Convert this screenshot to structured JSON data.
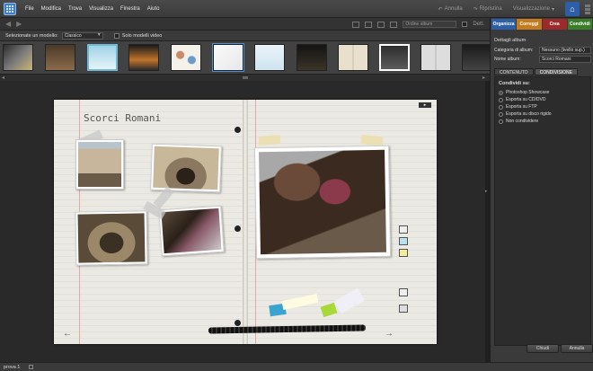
{
  "menubar": {
    "items": [
      "File",
      "Modifica",
      "Trova",
      "Visualizza",
      "Finestra",
      "Aiuto"
    ],
    "undo": "Annulla",
    "redo": "Ripristina",
    "display": "Visualizzazione"
  },
  "toolbar": {
    "sort_label": "Ordine album",
    "details_label": "Dett."
  },
  "template_row": {
    "label": "Selezionate un modello:",
    "selected": "Classico",
    "video_label": "Solo modelli video"
  },
  "album": {
    "title": "Scorci Romani",
    "page_button": "▸"
  },
  "right_panel": {
    "tabs": [
      "Organizza",
      "Correggi",
      "Crea",
      "Condividi"
    ],
    "section_title": "Dettagli album",
    "category_label": "Categoria di album:",
    "category_value": "Nessuno (livello sup.)",
    "name_label": "Nome album:",
    "name_value": "Scorci Romani",
    "subtabs": [
      "CONTENUTO",
      "CONDIVISIONE"
    ],
    "share_title": "Condividi su:",
    "share_options": [
      "Photoshop Showcase",
      "Esporta su CD/DVD",
      "Esporta su FTP",
      "Esporta su disco rigido",
      "Non condividere"
    ],
    "done_button": "Chiudi",
    "cancel_button": "Annulla"
  },
  "statusbar": {
    "text": "prova 1"
  },
  "colors": {
    "organize": "#2d5fa6",
    "fix": "#c47a1d",
    "create": "#9c2a2a",
    "share": "#3a7d2a",
    "accent": "#4a8cd8"
  }
}
